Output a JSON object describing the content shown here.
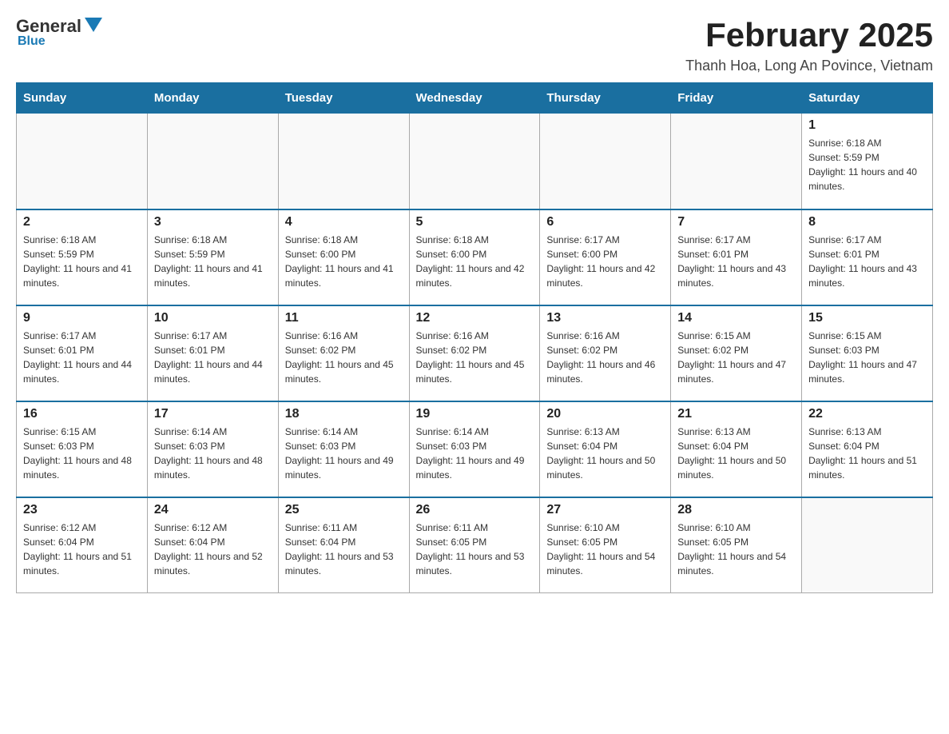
{
  "header": {
    "logo_general": "General",
    "logo_blue": "Blue",
    "title": "February 2025",
    "subtitle": "Thanh Hoa, Long An Povince, Vietnam"
  },
  "days_of_week": [
    "Sunday",
    "Monday",
    "Tuesday",
    "Wednesday",
    "Thursday",
    "Friday",
    "Saturday"
  ],
  "weeks": [
    [
      {
        "day": "",
        "info": ""
      },
      {
        "day": "",
        "info": ""
      },
      {
        "day": "",
        "info": ""
      },
      {
        "day": "",
        "info": ""
      },
      {
        "day": "",
        "info": ""
      },
      {
        "day": "",
        "info": ""
      },
      {
        "day": "1",
        "info": "Sunrise: 6:18 AM\nSunset: 5:59 PM\nDaylight: 11 hours and 40 minutes."
      }
    ],
    [
      {
        "day": "2",
        "info": "Sunrise: 6:18 AM\nSunset: 5:59 PM\nDaylight: 11 hours and 41 minutes."
      },
      {
        "day": "3",
        "info": "Sunrise: 6:18 AM\nSunset: 5:59 PM\nDaylight: 11 hours and 41 minutes."
      },
      {
        "day": "4",
        "info": "Sunrise: 6:18 AM\nSunset: 6:00 PM\nDaylight: 11 hours and 41 minutes."
      },
      {
        "day": "5",
        "info": "Sunrise: 6:18 AM\nSunset: 6:00 PM\nDaylight: 11 hours and 42 minutes."
      },
      {
        "day": "6",
        "info": "Sunrise: 6:17 AM\nSunset: 6:00 PM\nDaylight: 11 hours and 42 minutes."
      },
      {
        "day": "7",
        "info": "Sunrise: 6:17 AM\nSunset: 6:01 PM\nDaylight: 11 hours and 43 minutes."
      },
      {
        "day": "8",
        "info": "Sunrise: 6:17 AM\nSunset: 6:01 PM\nDaylight: 11 hours and 43 minutes."
      }
    ],
    [
      {
        "day": "9",
        "info": "Sunrise: 6:17 AM\nSunset: 6:01 PM\nDaylight: 11 hours and 44 minutes."
      },
      {
        "day": "10",
        "info": "Sunrise: 6:17 AM\nSunset: 6:01 PM\nDaylight: 11 hours and 44 minutes."
      },
      {
        "day": "11",
        "info": "Sunrise: 6:16 AM\nSunset: 6:02 PM\nDaylight: 11 hours and 45 minutes."
      },
      {
        "day": "12",
        "info": "Sunrise: 6:16 AM\nSunset: 6:02 PM\nDaylight: 11 hours and 45 minutes."
      },
      {
        "day": "13",
        "info": "Sunrise: 6:16 AM\nSunset: 6:02 PM\nDaylight: 11 hours and 46 minutes."
      },
      {
        "day": "14",
        "info": "Sunrise: 6:15 AM\nSunset: 6:02 PM\nDaylight: 11 hours and 47 minutes."
      },
      {
        "day": "15",
        "info": "Sunrise: 6:15 AM\nSunset: 6:03 PM\nDaylight: 11 hours and 47 minutes."
      }
    ],
    [
      {
        "day": "16",
        "info": "Sunrise: 6:15 AM\nSunset: 6:03 PM\nDaylight: 11 hours and 48 minutes."
      },
      {
        "day": "17",
        "info": "Sunrise: 6:14 AM\nSunset: 6:03 PM\nDaylight: 11 hours and 48 minutes."
      },
      {
        "day": "18",
        "info": "Sunrise: 6:14 AM\nSunset: 6:03 PM\nDaylight: 11 hours and 49 minutes."
      },
      {
        "day": "19",
        "info": "Sunrise: 6:14 AM\nSunset: 6:03 PM\nDaylight: 11 hours and 49 minutes."
      },
      {
        "day": "20",
        "info": "Sunrise: 6:13 AM\nSunset: 6:04 PM\nDaylight: 11 hours and 50 minutes."
      },
      {
        "day": "21",
        "info": "Sunrise: 6:13 AM\nSunset: 6:04 PM\nDaylight: 11 hours and 50 minutes."
      },
      {
        "day": "22",
        "info": "Sunrise: 6:13 AM\nSunset: 6:04 PM\nDaylight: 11 hours and 51 minutes."
      }
    ],
    [
      {
        "day": "23",
        "info": "Sunrise: 6:12 AM\nSunset: 6:04 PM\nDaylight: 11 hours and 51 minutes."
      },
      {
        "day": "24",
        "info": "Sunrise: 6:12 AM\nSunset: 6:04 PM\nDaylight: 11 hours and 52 minutes."
      },
      {
        "day": "25",
        "info": "Sunrise: 6:11 AM\nSunset: 6:04 PM\nDaylight: 11 hours and 53 minutes."
      },
      {
        "day": "26",
        "info": "Sunrise: 6:11 AM\nSunset: 6:05 PM\nDaylight: 11 hours and 53 minutes."
      },
      {
        "day": "27",
        "info": "Sunrise: 6:10 AM\nSunset: 6:05 PM\nDaylight: 11 hours and 54 minutes."
      },
      {
        "day": "28",
        "info": "Sunrise: 6:10 AM\nSunset: 6:05 PM\nDaylight: 11 hours and 54 minutes."
      },
      {
        "day": "",
        "info": ""
      }
    ]
  ]
}
